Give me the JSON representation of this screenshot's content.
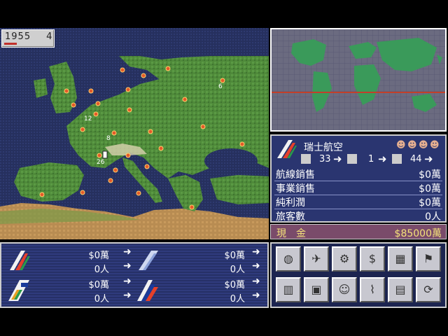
{
  "date": {
    "year": "1955",
    "month": "4"
  },
  "map": {
    "city_numbers": [
      "6",
      "12",
      "8",
      "26"
    ]
  },
  "airline": {
    "name": "瑞士航空",
    "stat1": "33",
    "stat2": "1",
    "stat3": "44",
    "rows": [
      {
        "label": "航線銷售",
        "value": "$0萬"
      },
      {
        "label": "事業銷售",
        "value": "$0萬"
      },
      {
        "label": "純利潤",
        "value": "$0萬"
      },
      {
        "label": "旅客數",
        "value": "0人"
      }
    ],
    "cash_label": "現　金",
    "cash_value": "$85000萬"
  },
  "competitors": [
    {
      "money": "$0萬",
      "people": "0人"
    },
    {
      "money": "$0萬",
      "people": "0人"
    },
    {
      "money": "$0萬",
      "people": "0人"
    },
    {
      "money": "$0萬",
      "people": "0人"
    }
  ],
  "icons": [
    "globe-icon",
    "airplane-icon",
    "engine-icon",
    "money-icon",
    "calculator-icon",
    "pin-icon",
    "building-icon",
    "tv-cm-icon",
    "person-icon",
    "radio-tower-icon",
    "disk-icon",
    "cycle-icon"
  ]
}
